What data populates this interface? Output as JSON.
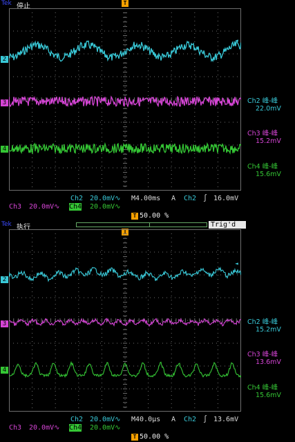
{
  "colors": {
    "ch2": "#39c9d8",
    "ch3": "#d645d6",
    "ch4": "#35c735",
    "grid": "#6f6f6f",
    "trigger": "#f5a000"
  },
  "panels": [
    {
      "brand": "Tek",
      "mode": "停止",
      "trig_state": "",
      "measurements": [
        {
          "label": "Ch2 峰-峰",
          "value": "22.0mV",
          "color": "#39c9d8"
        },
        {
          "label": "Ch3 峰-峰",
          "value": "15.2mV",
          "color": "#d645d6"
        },
        {
          "label": "Ch4 峰-峰",
          "value": "15.6mV",
          "color": "#35c735"
        }
      ],
      "status_row1": {
        "ch2": "Ch2",
        "ch2_scale": "20.0mV∿",
        "timebase": "M4.00ms",
        "trig_src_label": "A",
        "trig_ch": "Ch2",
        "trig_slope": "∫",
        "trig_level": "16.0mV"
      },
      "status_row2": {
        "ch3": "Ch3",
        "ch3_scale": "20.0mV∿",
        "ch4": "Ch4",
        "ch4_scale": "20.0mV∿"
      },
      "trigger_pos": ""
    },
    {
      "brand": "Tek",
      "mode": "执行",
      "trig_state": "Trig'd",
      "measurements": [
        {
          "label": "Ch2 峰-峰",
          "value": "15.2mV",
          "color": "#39c9d8"
        },
        {
          "label": "Ch3 峰-峰",
          "value": "13.6mV",
          "color": "#d645d6"
        },
        {
          "label": "Ch4 峰-峰",
          "value": "15.6mV",
          "color": "#35c735"
        }
      ],
      "status_row1": {
        "ch2": "Ch2",
        "ch2_scale": "20.0mV∿",
        "timebase": "M40.0µs",
        "trig_src_label": "A",
        "trig_ch": "Ch2",
        "trig_slope": "∫",
        "trig_level": "13.6mV"
      },
      "status_row2": {
        "ch3": "Ch3",
        "ch3_scale": "20.0mV∿",
        "ch4": "Ch4",
        "ch4_scale": "20.0mV∿"
      },
      "trigger_pos": "50.00 %"
    }
  ],
  "top_trigger_pos": "50.00 %",
  "channel_markers": [
    "2",
    "3",
    "4"
  ]
}
